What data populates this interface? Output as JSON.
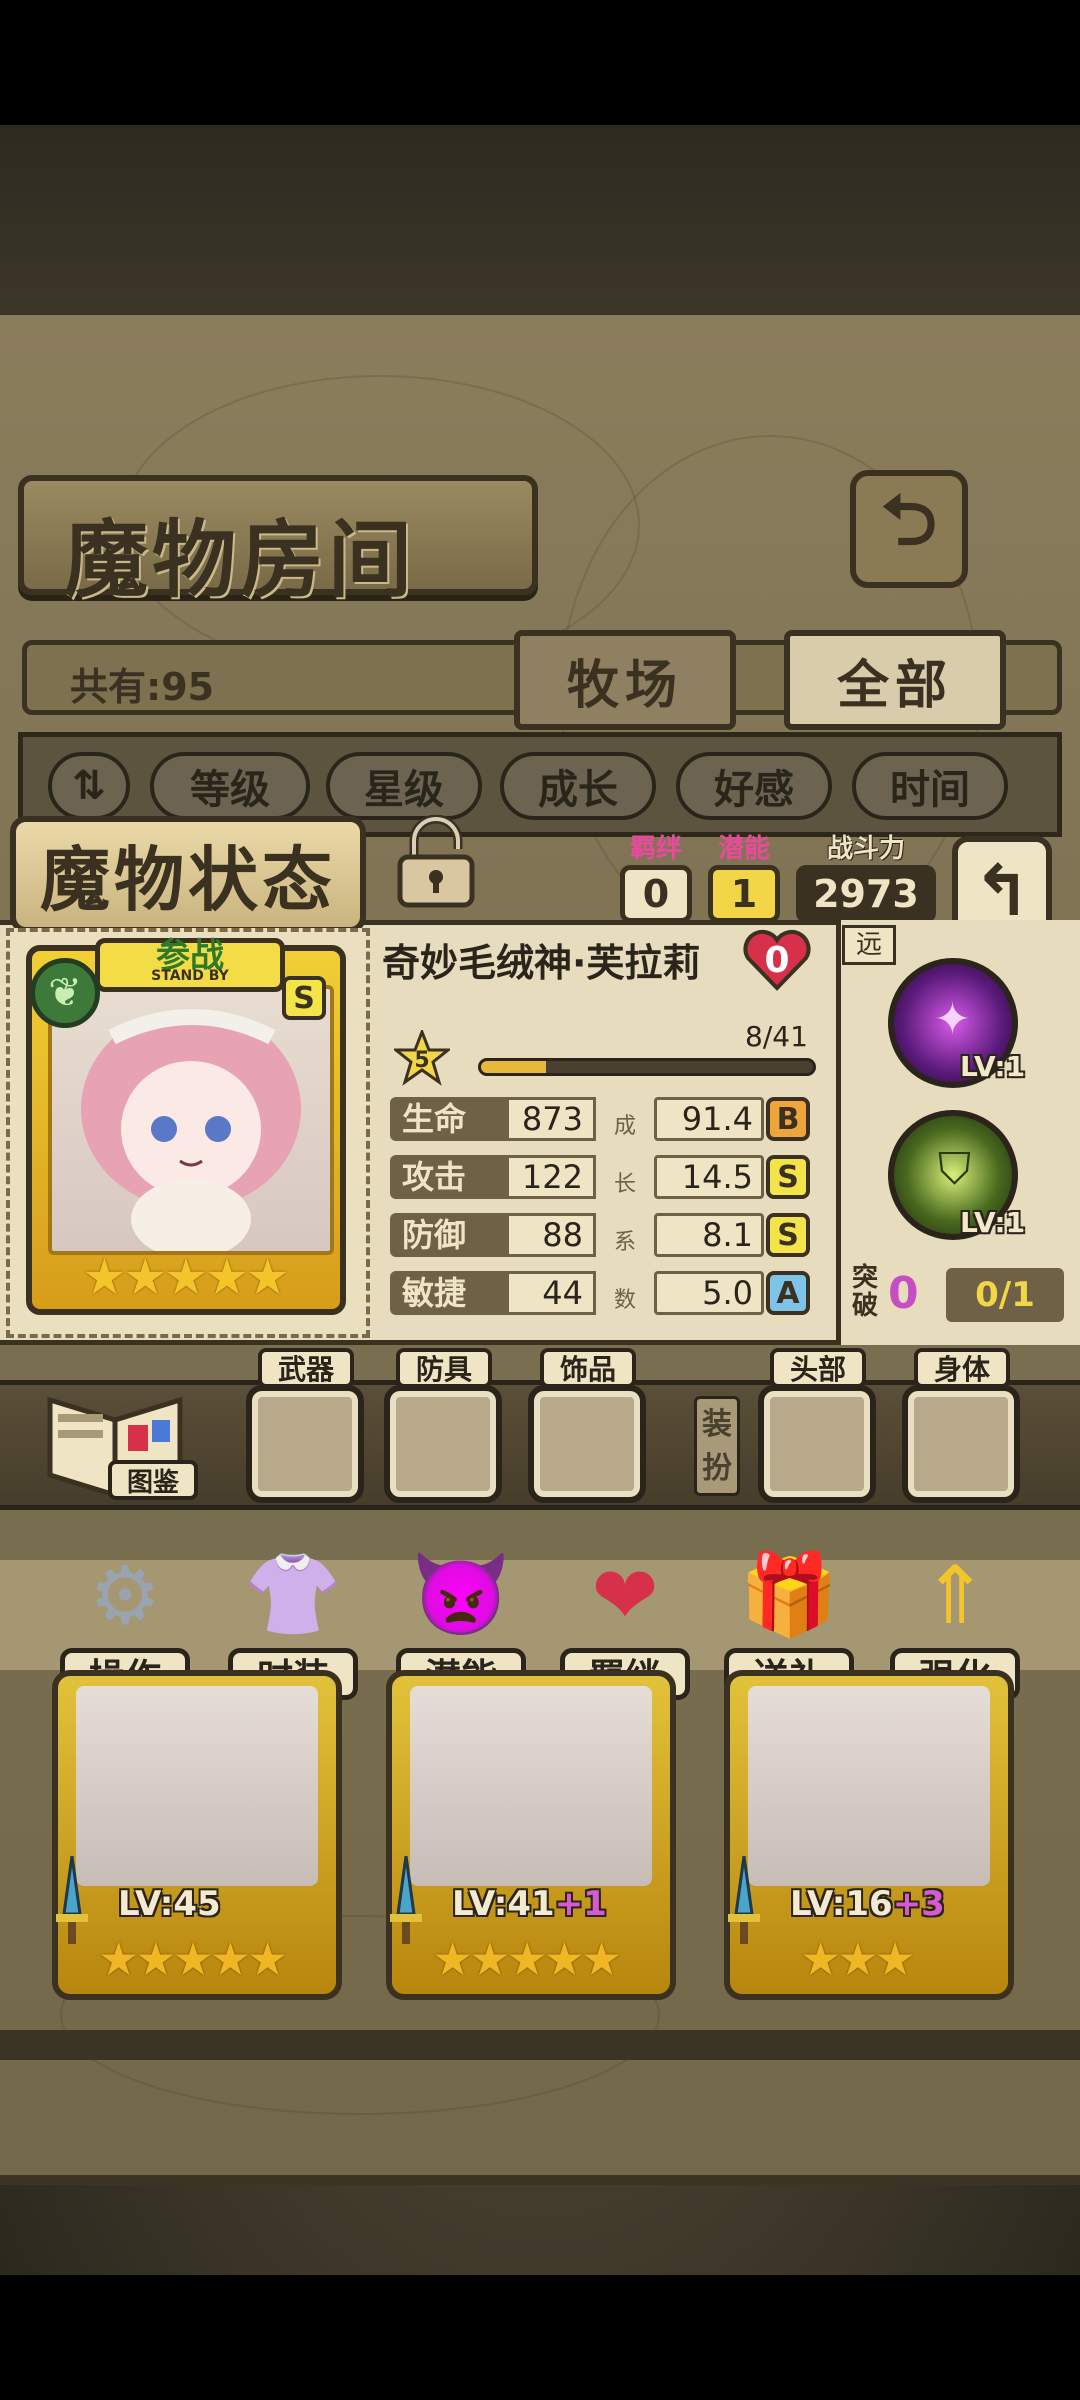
{
  "header": {
    "title": "魔物房间",
    "total_label": "共有:95",
    "tabs": [
      "牧场",
      "全部"
    ]
  },
  "sort": {
    "buttons": [
      "等级",
      "星级",
      "成长",
      "好感",
      "时间"
    ]
  },
  "status": {
    "title": "魔物状态",
    "bond_label": "羁绊",
    "bond_value": "0",
    "potential_label": "潜能",
    "potential_value": "1",
    "power_label": "战斗力",
    "power_value": "2973",
    "monster_name": "奇妙毛绒神·芙拉莉",
    "affection": "0",
    "card_badge": "参战",
    "card_badge_sub": "STAND BY",
    "rank": "S",
    "star_count": 5,
    "level": "5",
    "exp_text": "8/41",
    "exp_fraction": 0.195,
    "stats": [
      {
        "name": "生命",
        "value": "873",
        "growth": "91.4",
        "grade": "B"
      },
      {
        "name": "攻击",
        "value": "122",
        "growth": "14.5",
        "grade": "S"
      },
      {
        "name": "防御",
        "value": "88",
        "growth": "8.1",
        "grade": "S"
      },
      {
        "name": "敏捷",
        "value": "44",
        "growth": "5.0",
        "grade": "A"
      }
    ],
    "growth_caption": [
      "成",
      "长",
      "系",
      "数"
    ],
    "range_tag": "远",
    "skills": [
      {
        "lv": "LV:1"
      },
      {
        "lv": "LV:1"
      }
    ],
    "break_label": "突破",
    "break_value": "0",
    "break_progress": "0/1"
  },
  "equipment": {
    "codex_label": "图鉴",
    "slots": [
      "武器",
      "防具",
      "饰品",
      "头部",
      "身体"
    ],
    "outfit_label": "装扮"
  },
  "actions": [
    "操作",
    "时装",
    "潜能",
    "羁绊",
    "送礼",
    "强化"
  ],
  "monster_list": [
    {
      "lv": "LV:45",
      "plus": "",
      "stars": 5
    },
    {
      "lv": "LV:41",
      "plus": "+1",
      "stars": 5
    },
    {
      "lv": "LV:16",
      "plus": "+3",
      "stars": 3
    }
  ],
  "colors": {
    "accent_pink": "#e94a9b",
    "gold": "#f3c52b",
    "parchment": "#e7dcbd",
    "frame": "#3b3120"
  }
}
